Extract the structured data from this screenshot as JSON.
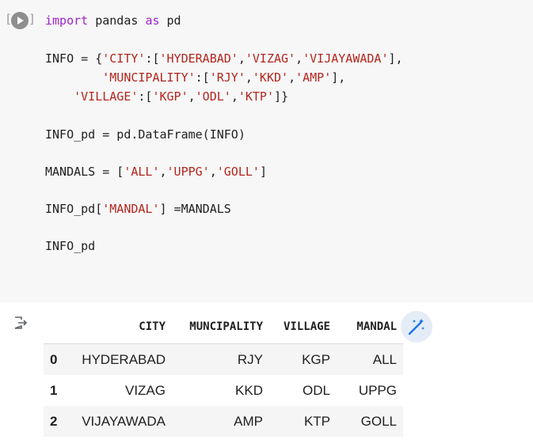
{
  "cell": {
    "execution_count": "[ ]"
  },
  "code": {
    "lines": [
      [
        {
          "t": "import",
          "c": "kw"
        },
        {
          "t": " pandas "
        },
        {
          "t": "as",
          "c": "kw"
        },
        {
          "t": " pd"
        }
      ],
      [],
      [
        {
          "t": "INFO = {"
        },
        {
          "t": "'CITY'",
          "c": "str"
        },
        {
          "t": ":["
        },
        {
          "t": "'HYDERABAD'",
          "c": "str"
        },
        {
          "t": ","
        },
        {
          "t": "'VIZAG'",
          "c": "str"
        },
        {
          "t": ","
        },
        {
          "t": "'VIJAYAWADA'",
          "c": "str"
        },
        {
          "t": "],"
        }
      ],
      [
        {
          "t": "        "
        },
        {
          "t": "'MUNCIPALITY'",
          "c": "str"
        },
        {
          "t": ":["
        },
        {
          "t": "'RJY'",
          "c": "str"
        },
        {
          "t": ","
        },
        {
          "t": "'KKD'",
          "c": "str"
        },
        {
          "t": ","
        },
        {
          "t": "'AMP'",
          "c": "str"
        },
        {
          "t": "],"
        }
      ],
      [
        {
          "t": "    "
        },
        {
          "t": "'VILLAGE'",
          "c": "str"
        },
        {
          "t": ":["
        },
        {
          "t": "'KGP'",
          "c": "str"
        },
        {
          "t": ","
        },
        {
          "t": "'ODL'",
          "c": "str"
        },
        {
          "t": ","
        },
        {
          "t": "'KTP'",
          "c": "str"
        },
        {
          "t": "]}"
        }
      ],
      [],
      [
        {
          "t": "INFO_pd = pd.DataFrame(INFO)"
        }
      ],
      [],
      [
        {
          "t": "MANDALS = ["
        },
        {
          "t": "'ALL'",
          "c": "str"
        },
        {
          "t": ","
        },
        {
          "t": "'UPPG'",
          "c": "str"
        },
        {
          "t": ","
        },
        {
          "t": "'GOLL'",
          "c": "str"
        },
        {
          "t": "]"
        }
      ],
      [],
      [
        {
          "t": "INFO_pd["
        },
        {
          "t": "'MANDAL'",
          "c": "str"
        },
        {
          "t": "] =MANDALS"
        }
      ],
      [],
      [
        {
          "t": "INFO_pd"
        }
      ]
    ]
  },
  "output": {
    "columns": [
      "",
      "CITY",
      "MUNCIPALITY",
      "VILLAGE",
      "MANDAL"
    ],
    "rows": [
      [
        "0",
        "HYDERABAD",
        "RJY",
        "KGP",
        "ALL"
      ],
      [
        "1",
        "VIZAG",
        "KKD",
        "ODL",
        "UPPG"
      ],
      [
        "2",
        "VIJAYAWADA",
        "AMP",
        "KTP",
        "GOLL"
      ]
    ]
  },
  "icons": {
    "run": "run-cell-icon",
    "output": "output-arrow-icon",
    "magic": "magic-wand-icon"
  },
  "colors": {
    "keyword": "#9b23c8",
    "string": "#b3261e",
    "cell_background": "#f7f7f7",
    "magic_button": "#e4ecf7",
    "magic_icon": "#1a73e8"
  }
}
